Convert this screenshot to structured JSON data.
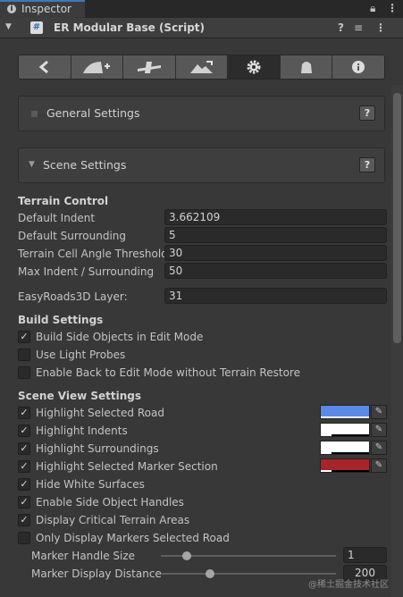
{
  "window": {
    "tab_title": "Inspector",
    "tab_icons": [
      "lock-icon",
      "more-options-icon"
    ]
  },
  "component": {
    "title": "ER Modular Base (Script)",
    "icons": [
      "help-icon",
      "preset-icon",
      "context-menu-icon"
    ]
  },
  "toolbar": {
    "buttons": [
      "back-arrow-icon",
      "add-road-icon",
      "road-junction-icon",
      "terrain-icon",
      "settings-gear-icon",
      "object-icon",
      "info-icon"
    ],
    "active_index": 4
  },
  "panels": {
    "general": {
      "label": "General Settings",
      "help": "?"
    },
    "scene": {
      "label": "Scene Settings",
      "help": "?"
    }
  },
  "terrain_control": {
    "title": "Terrain Control",
    "default_indent": {
      "label": "Default Indent",
      "value": "3.662109"
    },
    "default_surrounding": {
      "label": "Default Surrounding",
      "value": "5"
    },
    "cell_angle": {
      "label": "Terrain Cell Angle Threshold",
      "value": "30"
    },
    "max_indent": {
      "label": "Max Indent / Surrounding",
      "value": "50"
    },
    "layer": {
      "label": "EasyRoads3D Layer:",
      "value": "31"
    }
  },
  "build_settings": {
    "title": "Build Settings",
    "toggles": [
      {
        "label": "Build Side Objects in Edit Mode",
        "checked": true
      },
      {
        "label": "Use Light Probes",
        "checked": false
      },
      {
        "label": "Enable Back to Edit Mode without Terrain Restore",
        "checked": false
      }
    ]
  },
  "scene_view": {
    "title": "Scene View Settings",
    "toggles": [
      {
        "label": "Highlight Selected Road",
        "checked": true,
        "color": "#5b8ae6"
      },
      {
        "label": "Highlight Indents",
        "checked": true,
        "color": "#ffffff"
      },
      {
        "label": "Highlight Surroundings",
        "checked": true,
        "color": "#ffffff"
      },
      {
        "label": "Highlight Selected Marker Section",
        "checked": true,
        "color": "#a6242a"
      },
      {
        "label": "Hide White Surfaces",
        "checked": true
      },
      {
        "label": "Enable Side Object Handles",
        "checked": true
      },
      {
        "label": "Display Critical Terrain Areas",
        "checked": true
      },
      {
        "label": "Only Display Markers Selected Road",
        "checked": false
      }
    ],
    "marker_handle_size": {
      "label": "Marker Handle Size",
      "value": "1",
      "fraction": 0.15
    },
    "marker_display_distance": {
      "label": "Marker Display Distance",
      "value": "200",
      "fraction": 0.28
    }
  },
  "watermark": "@稀土掘金技术社区"
}
